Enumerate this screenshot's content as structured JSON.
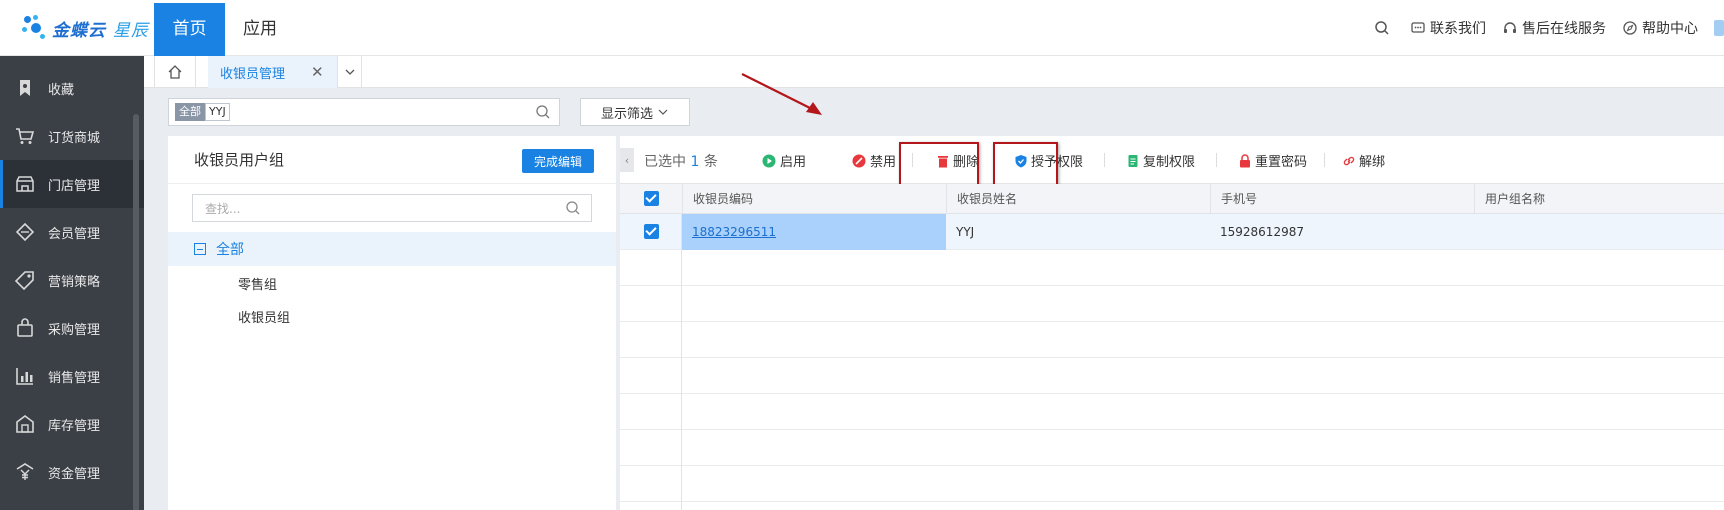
{
  "topbar": {
    "logo_text": "金蝶云",
    "logo_sub": "星辰",
    "tabs": [
      {
        "label": "首页",
        "active": true
      },
      {
        "label": "应用",
        "active": false
      }
    ],
    "right_items": [
      {
        "icon": "search-icon",
        "label": ""
      },
      {
        "icon": "chat-icon",
        "label": "联系我们"
      },
      {
        "icon": "headset-icon",
        "label": "售后在线服务"
      },
      {
        "icon": "compass-icon",
        "label": "帮助中心"
      }
    ]
  },
  "sidebar": {
    "items": [
      {
        "icon": "bookmark-icon",
        "label": "收藏"
      },
      {
        "icon": "cart-icon",
        "label": "订货商城"
      },
      {
        "icon": "store-icon",
        "label": "门店管理",
        "active": true
      },
      {
        "icon": "diamond-icon",
        "label": "会员管理"
      },
      {
        "icon": "tag-icon",
        "label": "营销策略"
      },
      {
        "icon": "bag-icon",
        "label": "采购管理"
      },
      {
        "icon": "chart-icon",
        "label": "销售管理"
      },
      {
        "icon": "warehouse-icon",
        "label": "库存管理"
      },
      {
        "icon": "yen-icon",
        "label": "资金管理"
      }
    ]
  },
  "tabbar": {
    "home_icon": "home-icon",
    "doc_tab": "收银员管理",
    "close": "✕",
    "more": "⌄"
  },
  "filter": {
    "chip_all": "全部",
    "chip_value": "YYJ",
    "show_filter": "显示筛选"
  },
  "left_panel": {
    "title": "收银员用户组",
    "done_button": "完成编辑",
    "search_placeholder": "查找...",
    "tree_root": "全部",
    "children": [
      "零售组",
      "收银员组"
    ]
  },
  "toolbar": {
    "selected_prefix": "已选中",
    "selected_count": "1",
    "selected_suffix": "条",
    "buttons": [
      {
        "label": "启用",
        "color": "#2bb673"
      },
      {
        "label": "禁用",
        "color": "#e8383d"
      },
      {
        "label": "删除",
        "color": "#e8383d"
      },
      {
        "label": "授予权限",
        "color": "#1a82e2"
      },
      {
        "label": "复制权限",
        "color": "#2bb673"
      },
      {
        "label": "重置密码",
        "color": "#e8383d"
      },
      {
        "label": "解绑",
        "color": "#e8383d"
      }
    ]
  },
  "grid": {
    "columns": [
      "收银员编码",
      "收银员姓名",
      "手机号",
      "用户组名称"
    ],
    "rows": [
      {
        "code": "18823296511",
        "name": "YYJ",
        "phone": "15928612987",
        "group": "",
        "checked": true
      }
    ]
  },
  "colors": {
    "accent": "#1a82e2",
    "sidebar_bg": "#3b3f46",
    "highlight_box": "#b3171b"
  }
}
